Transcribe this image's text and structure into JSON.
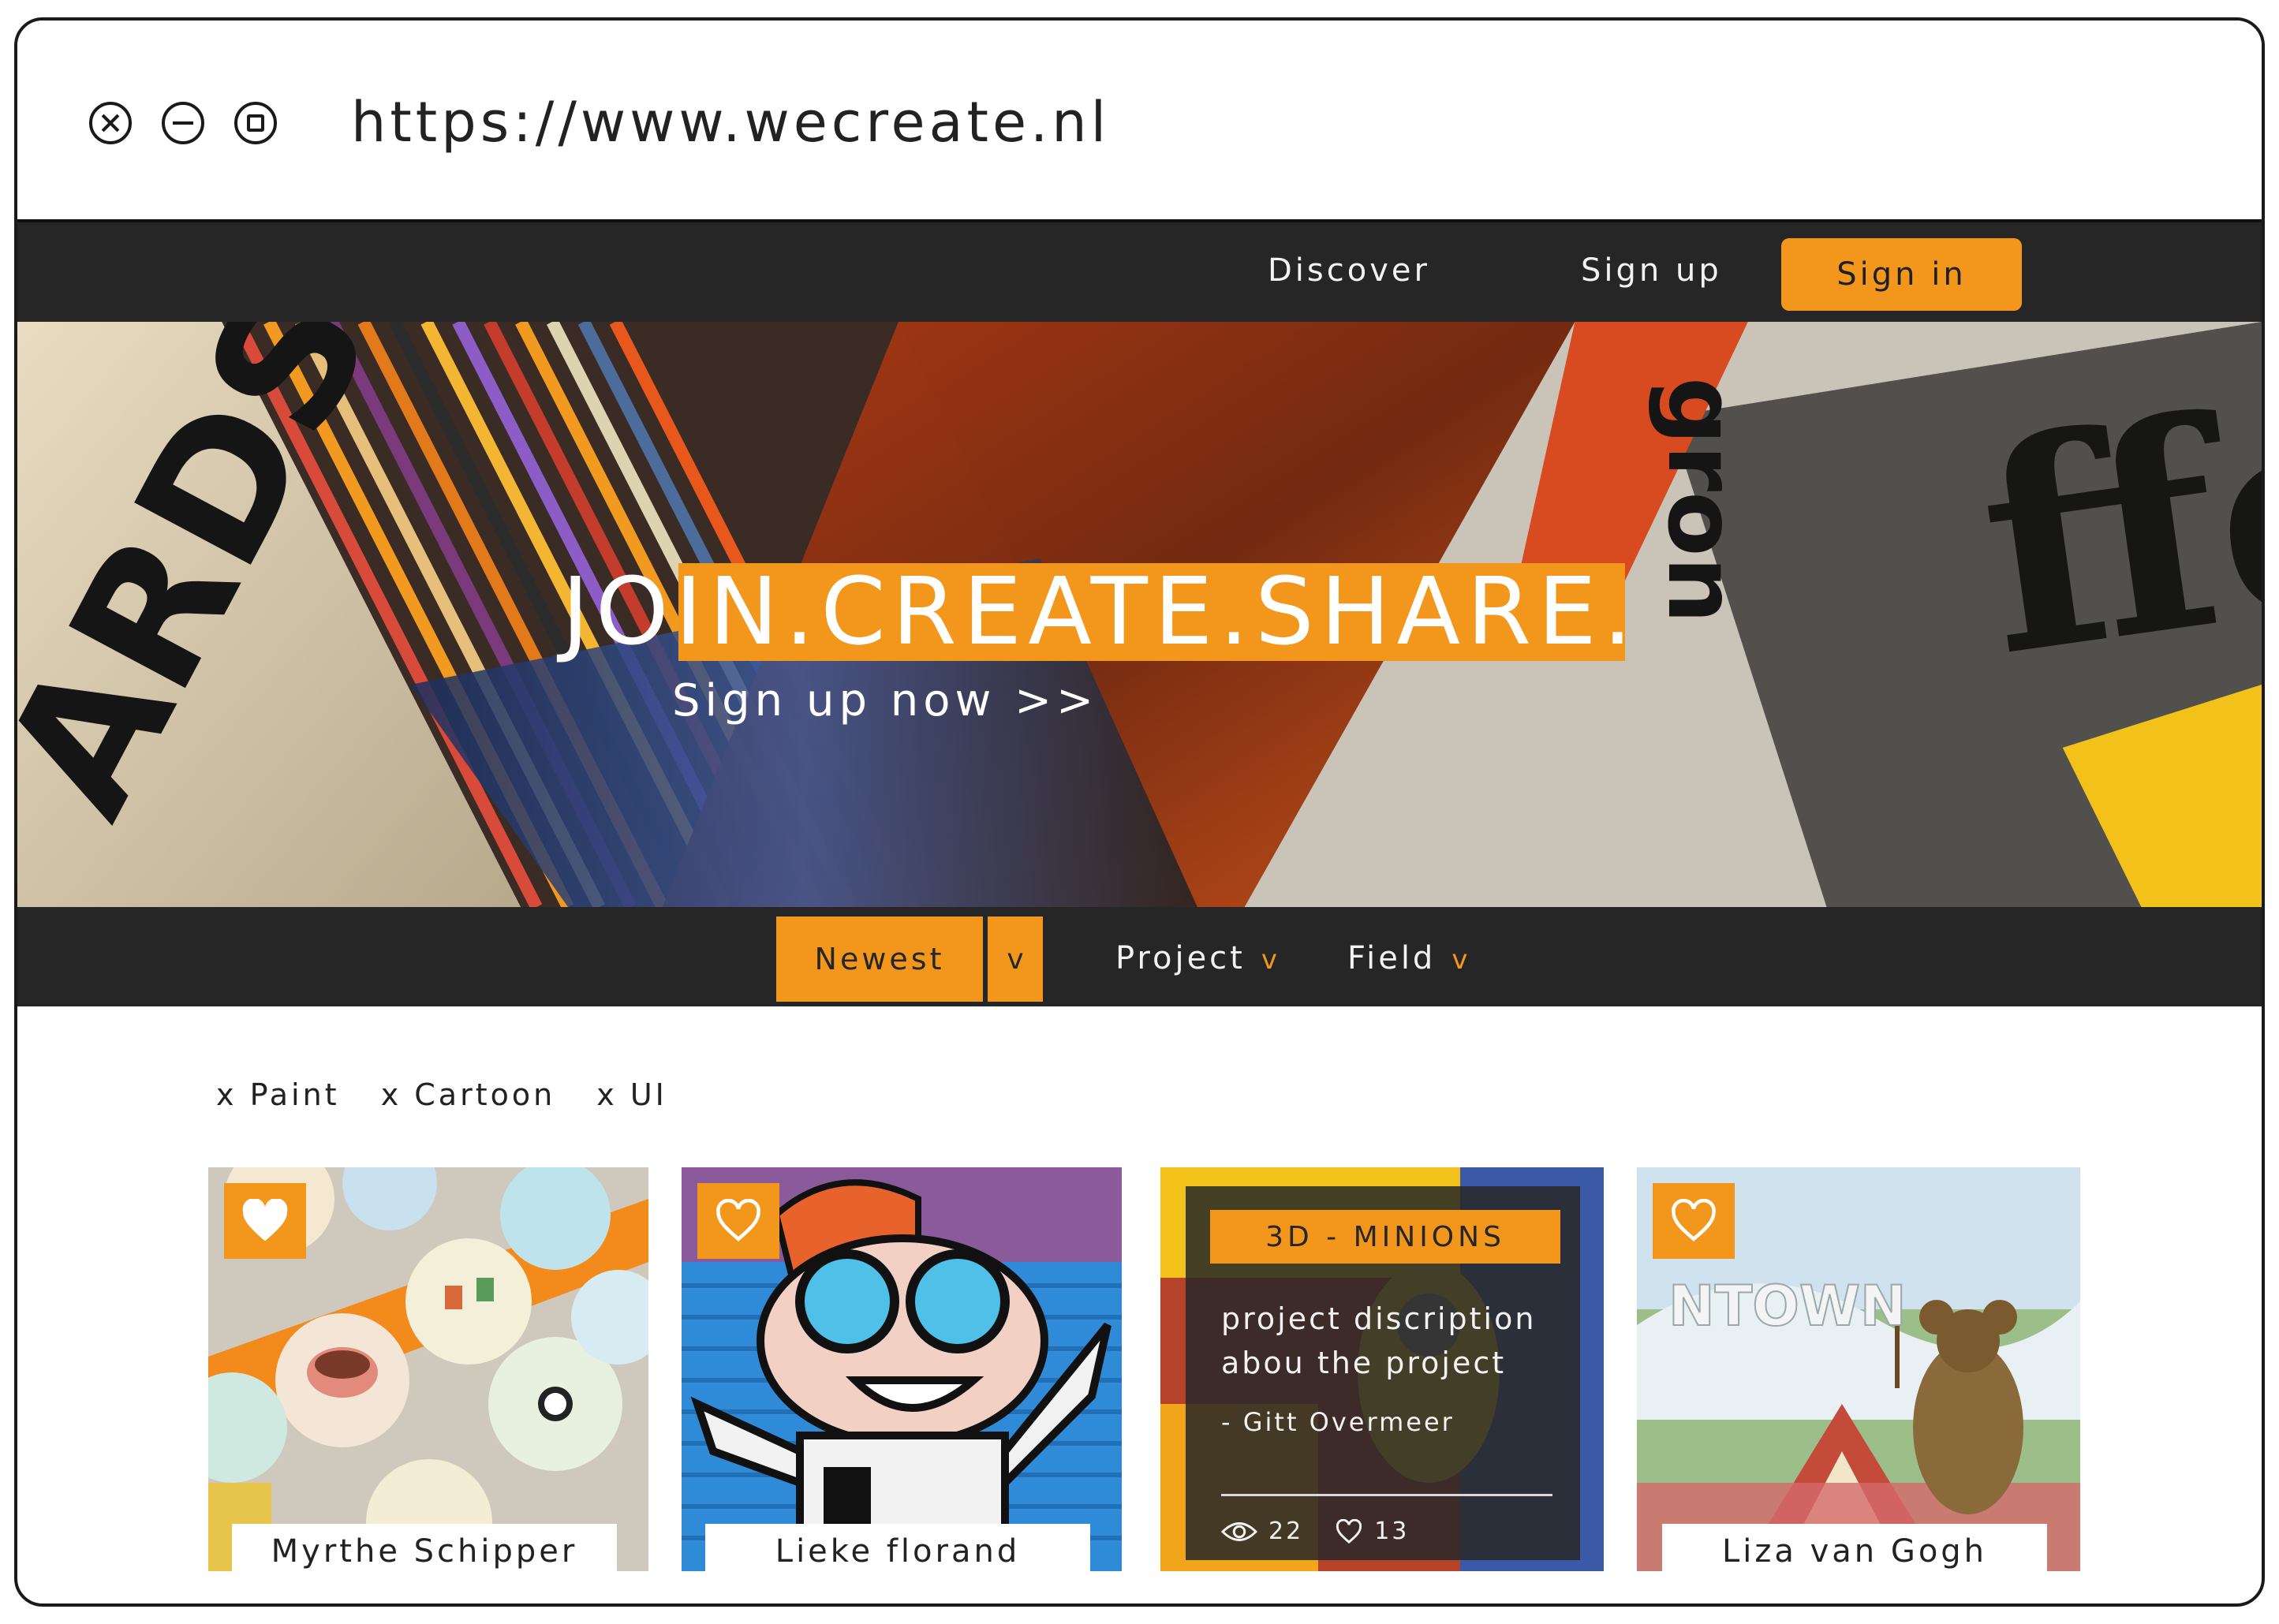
{
  "browser": {
    "url": "https://www.wecreate.nl",
    "buttons": [
      "close",
      "minimize",
      "maximize"
    ]
  },
  "nav": {
    "discover": "Discover",
    "sign_up": "Sign up",
    "sign_in": "Sign in"
  },
  "hero": {
    "title": "JOIN.CREATE.SHARE.",
    "cta": "Sign up now >>"
  },
  "filters": {
    "sort_selected": "Newest",
    "sort_arrow": "v",
    "project": "Project",
    "project_arrow": "v",
    "field": "Field",
    "field_arrow": "v"
  },
  "active_tags": [
    "x Paint",
    "x Cartoon",
    "x UI"
  ],
  "cards": [
    {
      "author": "Myrthe Schipper",
      "favorited": true
    },
    {
      "author": "Lieke florand",
      "favorited": false
    },
    {
      "title": "3D - MINIONS",
      "description": "project discription abou the project",
      "author": "- Gitt Overmeer",
      "views": "22",
      "likes": "13"
    },
    {
      "author": "Liza van Gogh",
      "favorited": false
    }
  ],
  "colors": {
    "accent": "#f2971c",
    "dark": "#262626",
    "light": "#ffffff"
  },
  "icons": {
    "favorite": "heart-icon",
    "views": "eye-icon",
    "likes": "heart-outline-icon"
  }
}
